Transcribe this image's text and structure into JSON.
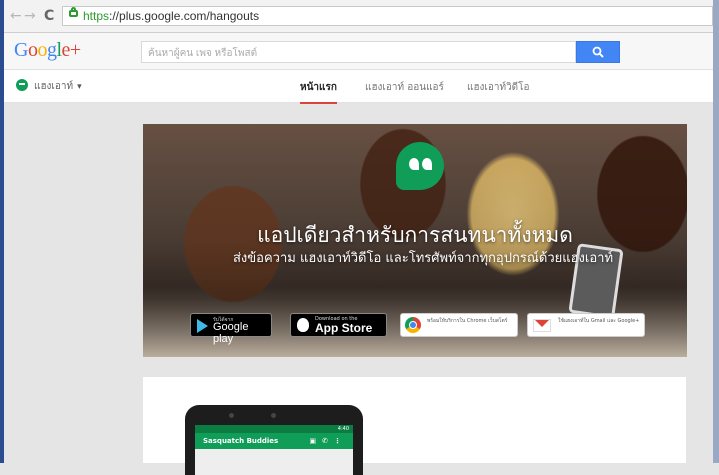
{
  "browser": {
    "back_icon": "←",
    "forward_icon": "→",
    "reload_icon": "C",
    "url_scheme": "https",
    "url_rest": "://plus.google.com/hangouts"
  },
  "header": {
    "logo": "Google+",
    "search_placeholder": "ค้นหาผู้คน เพจ หรือโพสต์"
  },
  "subnav": {
    "app_label": "แฮงเอาท์",
    "tabs": [
      {
        "label": "หน้าแรก",
        "active": true
      },
      {
        "label": "แฮงเอาท์ ออนแอร์",
        "active": false
      },
      {
        "label": "แฮงเอาท์วิดีโอ",
        "active": false
      }
    ]
  },
  "banner": {
    "headline": "แอปเดียวสำหรับการสนทนาทั้งหมด",
    "subtext": "ส่งข้อความ แฮงเอาท์วิดีโอ และโทรศัพท์จากทุกอุปกรณ์ด้วยแฮงเอาท์",
    "badges": {
      "play_small": "รับได้จาก",
      "play_big": "Google play",
      "apple_small": "Download on the",
      "apple_big": "App Store",
      "chrome_text": "พร้อมให้บริการใน Chrome เว็บสโตร์",
      "gmail_text": "ใช้แฮงเอาท์ใน Gmail และ Google+"
    }
  },
  "phone": {
    "status_time": "4:40",
    "app_title": "Sasquatch Buddies"
  },
  "colors": {
    "google_blue": "#4285f4",
    "google_red": "#db4437",
    "google_yellow": "#f4b400",
    "google_green": "#0f9d58",
    "frame_blue": "#2a4d8f"
  }
}
